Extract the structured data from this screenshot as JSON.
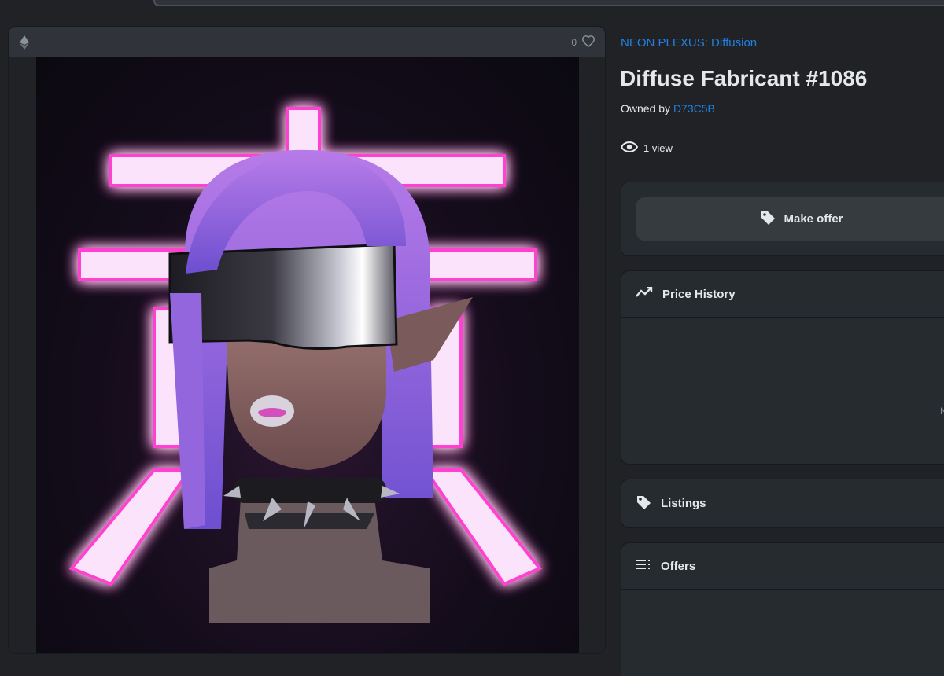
{
  "media": {
    "like_count": "0"
  },
  "item": {
    "collection": "NEON PLEXUS: Diffusion",
    "title": "Diffuse Fabricant #1086",
    "owned_by_label": "Owned by",
    "owner": "D73C5B",
    "views": "1 view"
  },
  "actions": {
    "make_offer": "Make offer"
  },
  "panels": {
    "price_history": "Price History",
    "price_history_clipped_text": "N",
    "listings": "Listings",
    "offers": "Offers"
  },
  "colors": {
    "accent_link": "#2081e2",
    "background": "#202225",
    "panel": "#262b2f",
    "neon": "#ff4fd8"
  },
  "icons": {
    "chain": "ethereum-icon",
    "favorite": "heart-icon",
    "views": "eye-icon",
    "offer": "tag-icon",
    "history": "trend-line-icon",
    "listings": "tag-icon",
    "offers": "list-icon"
  }
}
